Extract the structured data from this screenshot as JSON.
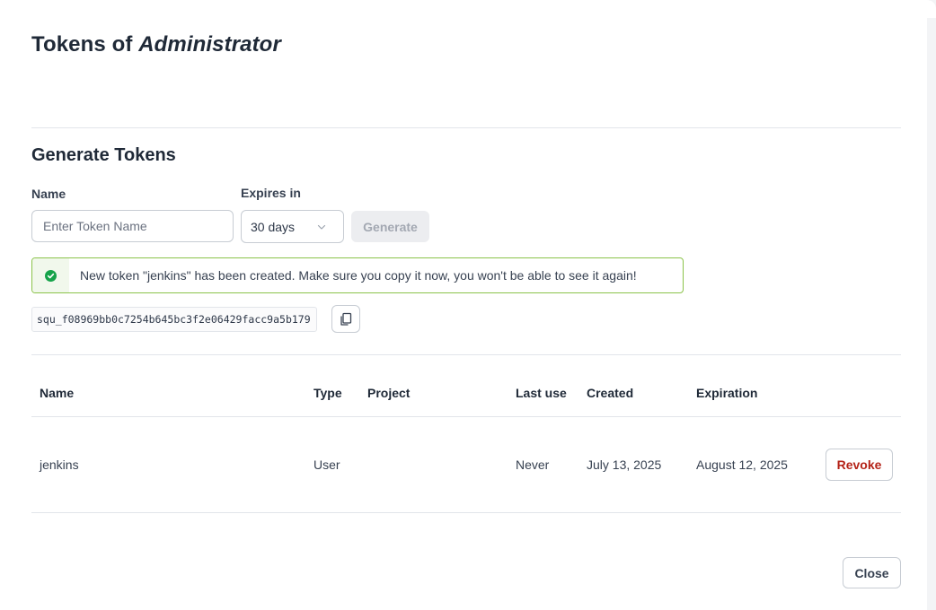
{
  "dialog": {
    "title_prefix": "Tokens of ",
    "title_user": "Administrator"
  },
  "generate": {
    "heading": "Generate Tokens",
    "name_label": "Name",
    "name_placeholder": "Enter Token Name",
    "name_value": "",
    "expires_label": "Expires in",
    "expires_value": "30 days",
    "generate_label": "Generate"
  },
  "alert": {
    "status": "success",
    "icon": "check-circle-icon",
    "message": "New token \"jenkins\" has been created. Make sure you copy it now, you won't be able to see it again!"
  },
  "token": {
    "value": "squ_f08969bb0c7254b645bc3f2e06429facc9a5b179",
    "copy_icon": "copy-icon"
  },
  "table": {
    "headers": {
      "name": "Name",
      "type": "Type",
      "project": "Project",
      "last_use": "Last use",
      "created": "Created",
      "expiration": "Expiration"
    },
    "rows": [
      {
        "name": "jenkins",
        "type": "User",
        "project": "",
        "last_use": "Never",
        "created": "July 13, 2025",
        "expiration": "August 12, 2025",
        "action": "Revoke"
      }
    ]
  },
  "footer": {
    "close_label": "Close"
  },
  "colors": {
    "success_border": "#8bc34a",
    "success_icon": "#16a34a",
    "danger_text": "#b42318",
    "disabled_bg": "#ecedf0"
  }
}
